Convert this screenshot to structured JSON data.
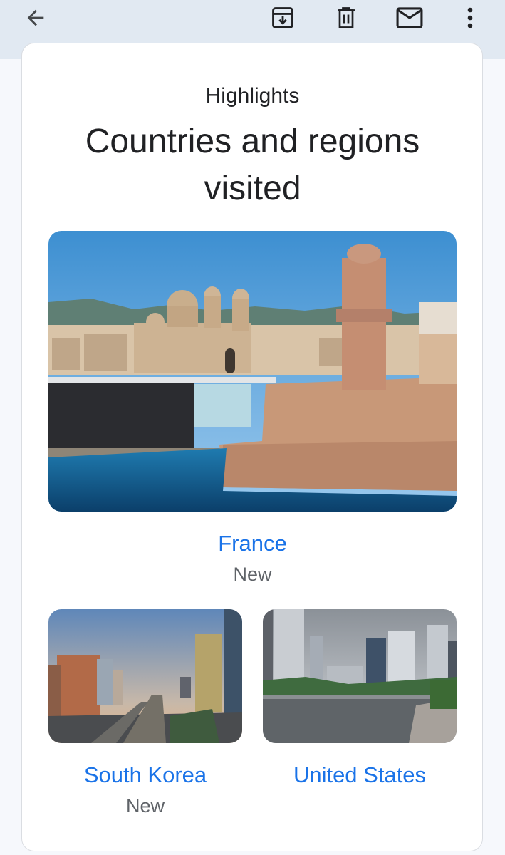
{
  "toolbar": {
    "icons": [
      "back-arrow-icon",
      "archive-icon",
      "delete-icon",
      "mail-icon",
      "more-vert-icon"
    ]
  },
  "card": {
    "eyebrow": "Highlights",
    "title": "Countries and regions visited",
    "places": [
      {
        "name": "France",
        "badge": "New",
        "image": "marseille-harbor-photo"
      },
      {
        "name": "South Korea",
        "badge": "New",
        "image": "seoul-city-photo"
      },
      {
        "name": "United States",
        "badge": "",
        "image": "miami-river-photo"
      }
    ]
  },
  "colors": {
    "toolbar_bg": "#e1e9f2",
    "link": "#1a73e8",
    "text": "#202124",
    "muted": "#5f6368"
  }
}
